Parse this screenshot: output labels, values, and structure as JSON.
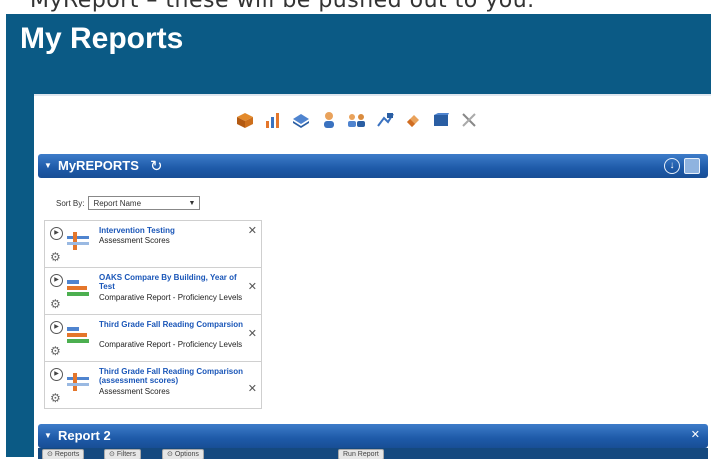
{
  "caption_fragment": "MyReport – these will be pushed out to you.",
  "page": {
    "title": "My Reports"
  },
  "toolbar": {
    "icons": [
      "cube-icon",
      "bar-chart-icon",
      "layers-icon",
      "person-icon",
      "group-icon",
      "flag-icon",
      "eraser-icon",
      "book-icon",
      "tools-icon"
    ]
  },
  "myreports": {
    "title": "MyREPORTS",
    "sort_label": "Sort By:",
    "sort_value": "Report Name",
    "reports": [
      {
        "title": "Intervention Testing",
        "subtitle": "Assessment Scores"
      },
      {
        "title": "OAKS Compare By Building, Year of Test",
        "subtitle": "Comparative Report - Proficiency Levels"
      },
      {
        "title": "Third Grade Fall Reading Comparsion",
        "subtitle": "Comparative Report - Proficiency Levels"
      },
      {
        "title": "Third Grade Fall Reading Comparison (assessment scores)",
        "subtitle": "Assessment Scores"
      }
    ]
  },
  "report2": {
    "title": "Report 2",
    "buttons": {
      "reports": "Reports",
      "filters": "Filters",
      "options": "Options",
      "run": "Run Report"
    }
  },
  "colors": {
    "frame": "#0b5a85",
    "bar": "#1e5aa8",
    "link": "#1a56b8"
  }
}
